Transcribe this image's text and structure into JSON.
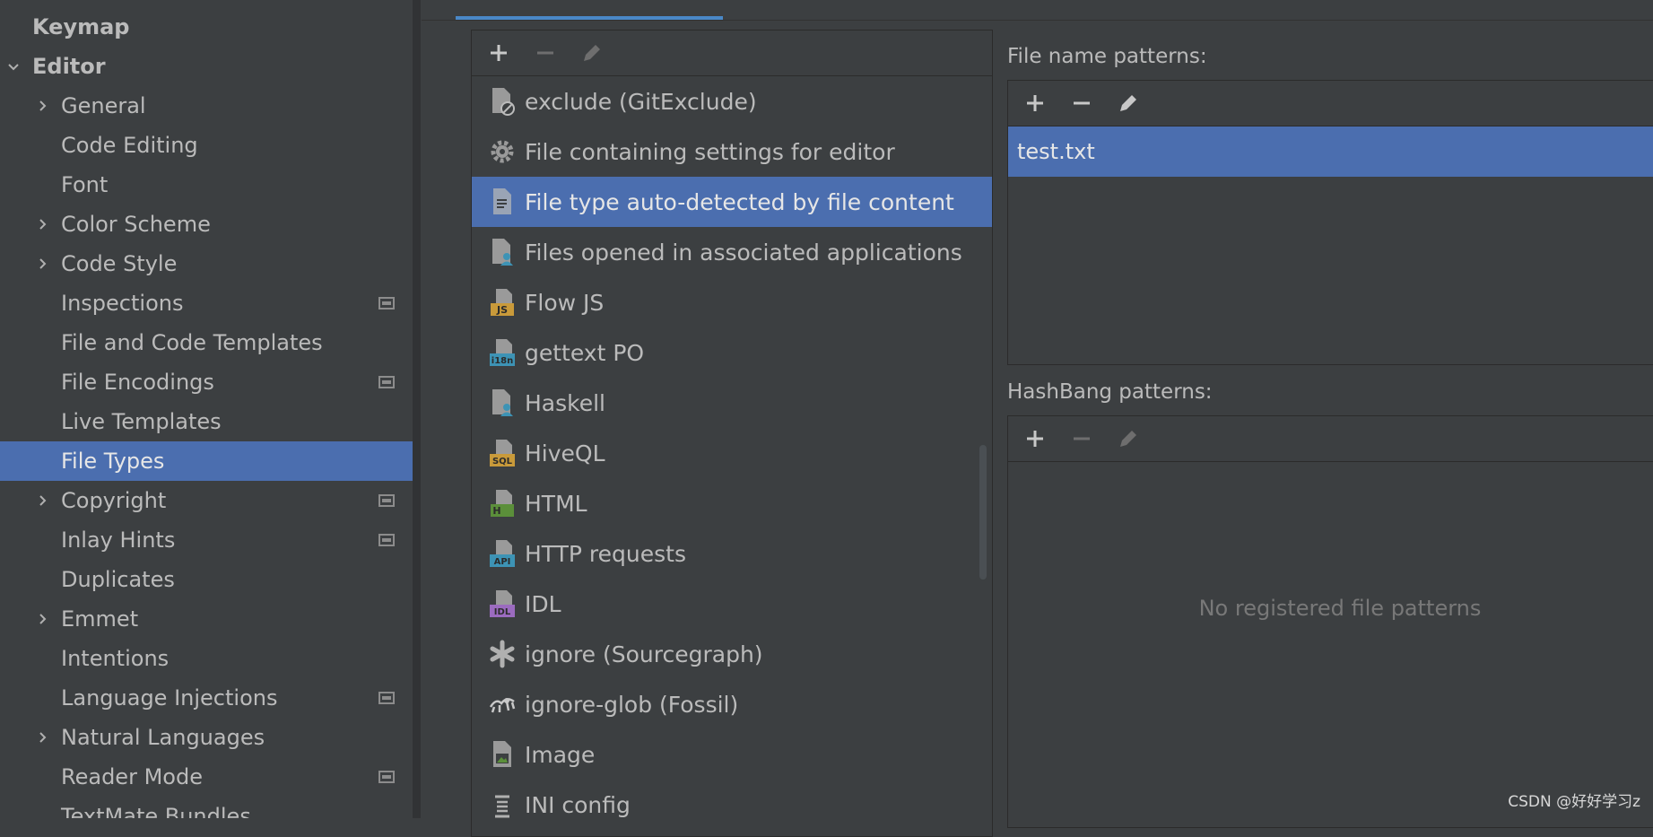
{
  "sidebar": {
    "items": [
      {
        "label": "Keymap",
        "bold": true
      },
      {
        "label": "Editor",
        "bold": true
      },
      {
        "label": "General"
      },
      {
        "label": "Code Editing"
      },
      {
        "label": "Font"
      },
      {
        "label": "Color Scheme"
      },
      {
        "label": "Code Style"
      },
      {
        "label": "Inspections"
      },
      {
        "label": "File and Code Templates"
      },
      {
        "label": "File Encodings"
      },
      {
        "label": "Live Templates"
      },
      {
        "label": "File Types"
      },
      {
        "label": "Copyright"
      },
      {
        "label": "Inlay Hints"
      },
      {
        "label": "Duplicates"
      },
      {
        "label": "Emmet"
      },
      {
        "label": "Intentions"
      },
      {
        "label": "Language Injections"
      },
      {
        "label": "Natural Languages"
      },
      {
        "label": "Reader Mode"
      },
      {
        "label": "TextMate Bundles"
      }
    ]
  },
  "file_types": {
    "items": [
      {
        "label": "exclude (GitExclude)",
        "icon": "git-exclude-icon"
      },
      {
        "label": "File containing settings for editor",
        "icon": "gear-icon"
      },
      {
        "label": "File type auto-detected by file content",
        "icon": "text-file-icon"
      },
      {
        "label": "Files opened in associated applications",
        "icon": "user-file-icon"
      },
      {
        "label": "Flow JS",
        "icon": "js-file-icon",
        "badge": "JS",
        "badge_color": "#c99a3a"
      },
      {
        "label": "gettext PO",
        "icon": "i18n-file-icon",
        "badge": "i18n",
        "badge_color": "#3d93b5"
      },
      {
        "label": "Haskell",
        "icon": "user-file-icon"
      },
      {
        "label": "HiveQL",
        "icon": "sql-file-icon",
        "badge": "SQL",
        "badge_color": "#c99a3a"
      },
      {
        "label": "HTML",
        "icon": "html-file-icon",
        "badge": "H",
        "badge_color": "#5b8f3a"
      },
      {
        "label": "HTTP requests",
        "icon": "api-file-icon",
        "badge": "API",
        "badge_color": "#3d93b5"
      },
      {
        "label": "IDL",
        "icon": "idl-file-icon",
        "badge": "IDL",
        "badge_color": "#9b6bbf"
      },
      {
        "label": "ignore (Sourcegraph)",
        "icon": "asterisk-icon"
      },
      {
        "label": "ignore-glob (Fossil)",
        "icon": "fossil-icon"
      },
      {
        "label": "Image",
        "icon": "image-file-icon"
      },
      {
        "label": "INI config",
        "icon": "ini-config-icon"
      }
    ]
  },
  "file_name_patterns": {
    "label": "File name patterns:",
    "items": [
      "test.txt"
    ]
  },
  "hashbang_patterns": {
    "label": "HashBang patterns:",
    "empty_text": "No registered file patterns"
  },
  "watermark": "CSDN @好好学习z"
}
